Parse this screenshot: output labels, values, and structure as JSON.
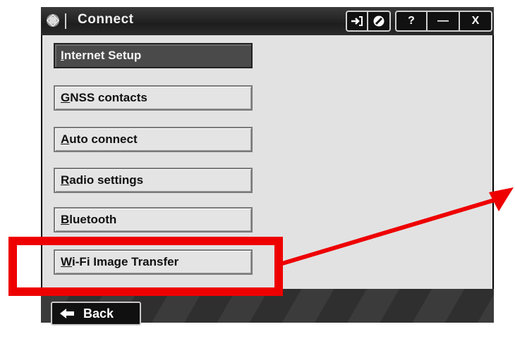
{
  "titlebar": {
    "title": "Connect",
    "buttons": {
      "help": "?",
      "minimize": "—",
      "close": "X"
    }
  },
  "menu": {
    "items": [
      {
        "prefix": "",
        "hotkey": "I",
        "rest": "nternet Setup",
        "active": true
      },
      {
        "prefix": "",
        "hotkey": "G",
        "rest": "NSS contacts",
        "active": false
      },
      {
        "prefix": "",
        "hotkey": "A",
        "rest": "uto connect",
        "active": false
      },
      {
        "prefix": "",
        "hotkey": "R",
        "rest": "adio settings",
        "active": false
      },
      {
        "prefix": "",
        "hotkey": "B",
        "rest": "luetooth",
        "active": false
      },
      {
        "prefix": "",
        "hotkey": "W",
        "rest": "i-Fi Image Transfer",
        "active": false
      }
    ]
  },
  "footer": {
    "back_label": "Back"
  },
  "annotation": {
    "color": "#ee0000"
  }
}
